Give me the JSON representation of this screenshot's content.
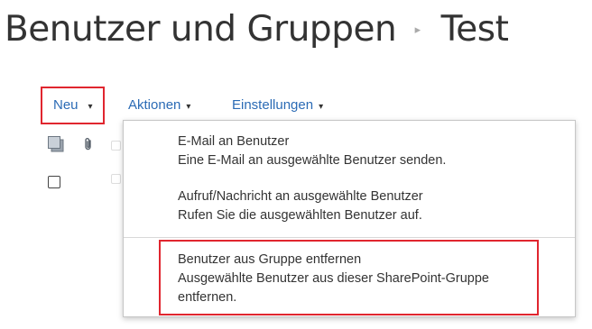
{
  "header": {
    "title": "Benutzer und Gruppen",
    "breadcrumb_separator": "▸",
    "subtitle": "Test"
  },
  "toolbar": {
    "new_label": "Neu",
    "actions_label": "Aktionen",
    "settings_label": "Einstellungen",
    "caret": "▾"
  },
  "menu": {
    "items": [
      {
        "title": "E-Mail an Benutzer",
        "description": "Eine E-Mail an ausgewählte Benutzer senden."
      },
      {
        "title": "Aufruf/Nachricht an ausgewählte Benutzer",
        "description": "Rufen Sie die ausgewählten Benutzer auf."
      },
      {
        "title": "Benutzer aus Gruppe entfernen",
        "description_line1": "Ausgewählte Benutzer aus dieser SharePoint-Gruppe",
        "description_line2": "entfernen."
      }
    ]
  },
  "colors": {
    "link_blue": "#2b6bb5",
    "highlight_red": "#e0262f",
    "text": "#333333"
  }
}
